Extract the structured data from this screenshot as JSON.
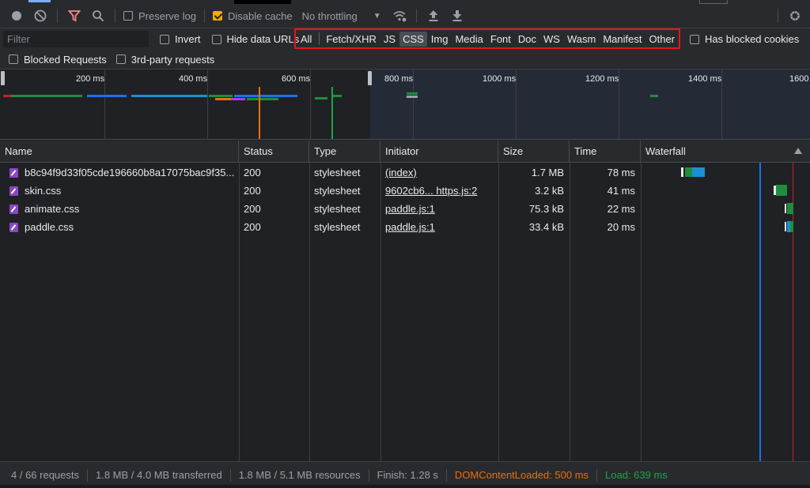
{
  "toolbar": {
    "preserve_log": "Preserve log",
    "disable_cache": "Disable cache",
    "throttling": "No throttling"
  },
  "filterbar": {
    "filter_placeholder": "Filter",
    "invert": "Invert",
    "hide_data_urls": "Hide data URLs",
    "types": [
      "All",
      "Fetch/XHR",
      "JS",
      "CSS",
      "Img",
      "Media",
      "Font",
      "Doc",
      "WS",
      "Wasm",
      "Manifest",
      "Other"
    ],
    "active_type": "CSS",
    "has_blocked_cookies": "Has blocked cookies",
    "blocked_requests": "Blocked Requests",
    "third_party": "3rd-party requests"
  },
  "overview": {
    "ticks": [
      "200 ms",
      "400 ms",
      "600 ms",
      "800 ms",
      "1000 ms",
      "1200 ms",
      "1400 ms",
      "1600"
    ]
  },
  "columns": {
    "name": "Name",
    "status": "Status",
    "type": "Type",
    "initiator": "Initiator",
    "size": "Size",
    "time": "Time",
    "waterfall": "Waterfall"
  },
  "rows": [
    {
      "name": "b8c94f9d33f05cde196660b8a17075bac9f35...",
      "status": "200",
      "type": "stylesheet",
      "initiator": "(index)",
      "size": "1.7 MB",
      "time": "78 ms"
    },
    {
      "name": "skin.css",
      "status": "200",
      "type": "stylesheet",
      "initiator": "9602cb6... https.js:2",
      "size": "3.2 kB",
      "time": "41 ms"
    },
    {
      "name": "animate.css",
      "status": "200",
      "type": "stylesheet",
      "initiator": "paddle.js:1",
      "size": "75.3 kB",
      "time": "22 ms"
    },
    {
      "name": "paddle.css",
      "status": "200",
      "type": "stylesheet",
      "initiator": "paddle.js:1",
      "size": "33.4 kB",
      "time": "20 ms"
    }
  ],
  "status": {
    "requests": "4 / 66 requests",
    "transferred": "1.8 MB / 4.0 MB transferred",
    "resources": "1.8 MB / 5.1 MB resources",
    "finish": "Finish: 1.28 s",
    "dom_content_loaded": "DOMContentLoaded: 500 ms",
    "load": "Load: 639 ms"
  },
  "colors": {
    "dom_content_loaded": "#e8710a",
    "load": "#1ea446",
    "highlight": "#e8141b"
  }
}
